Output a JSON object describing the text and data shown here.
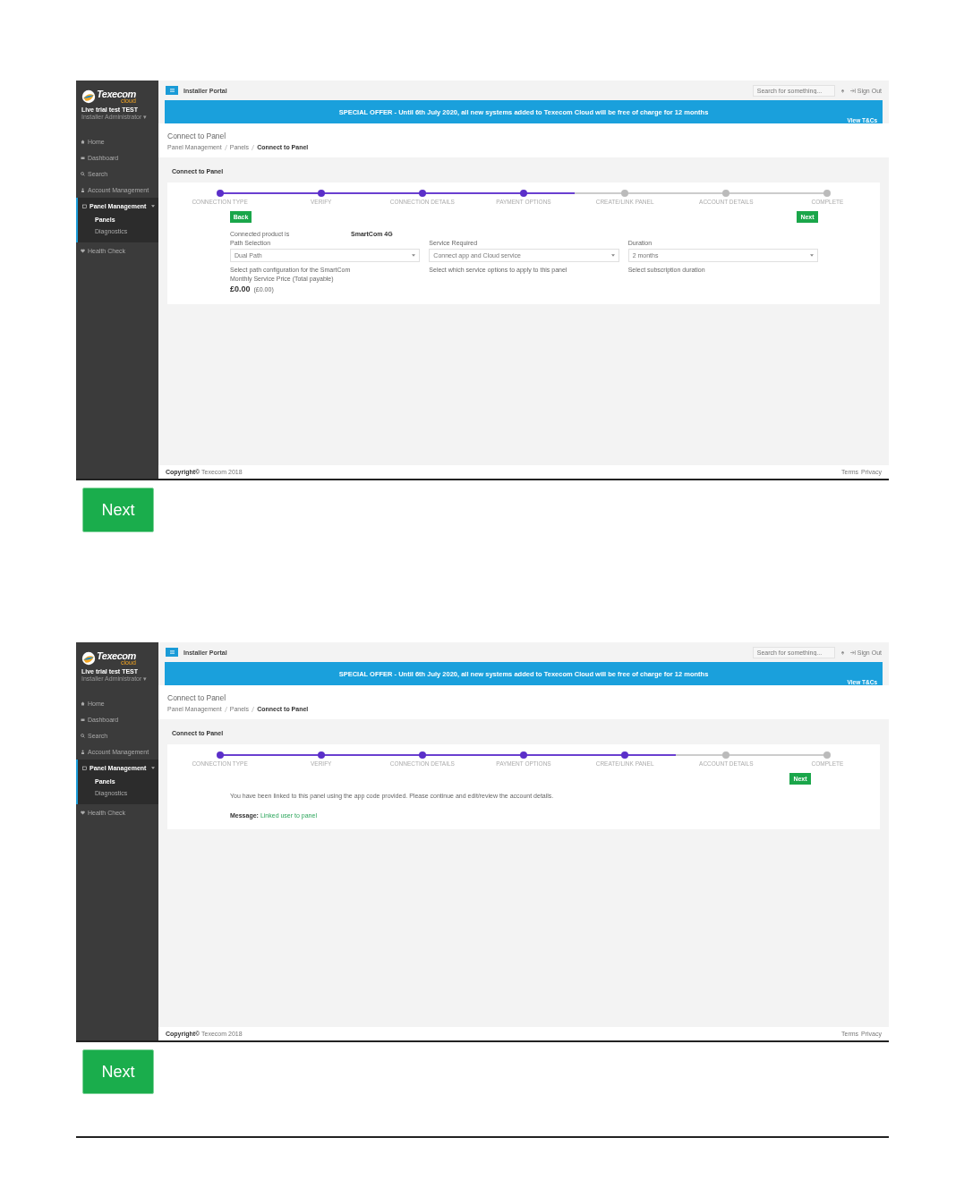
{
  "screenshots": [
    {
      "logo": {
        "name": "Texecom",
        "sub": "cloud"
      },
      "account": {
        "name": "Live trial test TEST",
        "role": "Installer Administrator ▾"
      },
      "nav": [
        {
          "label": "Home",
          "selected": false
        },
        {
          "label": "Dashboard",
          "selected": false
        },
        {
          "label": "Search",
          "selected": false
        },
        {
          "label": "Account Management",
          "selected": false
        },
        {
          "label": "Panel Management",
          "selected": true,
          "expanded": true,
          "children": [
            {
              "label": "Panels",
              "selected": true
            },
            {
              "label": "Diagnostics",
              "selected": false
            }
          ]
        },
        {
          "label": "Health Check",
          "selected": false
        }
      ],
      "header": {
        "title": "Installer Portal",
        "search_placeholder": "Search for something...",
        "sign_out": "Sign Out"
      },
      "banner": {
        "text": "SPECIAL OFFER - Until 6th July 2020, all new systems added to Texecom Cloud will be free of charge for 12 months",
        "link": "View T&Cs"
      },
      "page_title": "Connect to Panel",
      "breadcrumbs": [
        "Panel Management",
        "Panels",
        "Connect to Panel"
      ],
      "card_title": "Connect to Panel",
      "steps": [
        {
          "label": "CONNECTION TYPE",
          "done": true
        },
        {
          "label": "VERIFY",
          "done": true
        },
        {
          "label": "CONNECTION DETAILS",
          "done": true
        },
        {
          "label": "PAYMENT OPTIONS",
          "done": true
        },
        {
          "label": "CREATE/LINK PANEL",
          "done": false
        },
        {
          "label": "ACCOUNT DETAILS",
          "done": false
        },
        {
          "label": "COMPLETE",
          "done": false
        }
      ],
      "body": {
        "kind": "form",
        "back_button": "Back",
        "next_button": "Next",
        "product_label": "Connected product is",
        "product_value": "SmartCom 4G",
        "selects": [
          {
            "label": "Path Selection",
            "value": "Dual Path",
            "hint": "Select path configuration for the SmartCom"
          },
          {
            "label": "Service Required",
            "value": "Connect app and Cloud service",
            "hint": "Select which service options to apply to this panel"
          },
          {
            "label": "Duration",
            "value": "2 months",
            "hint": "Select subscription duration"
          }
        ],
        "price_label": "Monthly Service Price (Total payable)",
        "price": "£0.00",
        "price_note": "(£0.00)"
      },
      "footer": {
        "copyright": "**Copyright©** Texecom 2018",
        "links": [
          "Terms",
          "Privacy"
        ]
      }
    },
    {
      "logo": {
        "name": "Texecom",
        "sub": "cloud"
      },
      "account": {
        "name": "Live trial test TEST",
        "role": "Installer Administrator ▾"
      },
      "nav": [
        {
          "label": "Home",
          "selected": false
        },
        {
          "label": "Dashboard",
          "selected": false
        },
        {
          "label": "Search",
          "selected": false
        },
        {
          "label": "Account Management",
          "selected": false
        },
        {
          "label": "Panel Management",
          "selected": true,
          "expanded": true,
          "children": [
            {
              "label": "Panels",
              "selected": true
            },
            {
              "label": "Diagnostics",
              "selected": false
            }
          ]
        },
        {
          "label": "Health Check",
          "selected": false
        }
      ],
      "header": {
        "title": "Installer Portal",
        "search_placeholder": "Search for something...",
        "sign_out": "Sign Out"
      },
      "banner": {
        "text": "SPECIAL OFFER - Until 6th July 2020, all new systems added to Texecom Cloud will be free of charge for 12 months",
        "link": "View T&Cs"
      },
      "page_title": "Connect to Panel",
      "breadcrumbs": [
        "Panel Management",
        "Panels",
        "Connect to Panel"
      ],
      "card_title": "Connect to Panel",
      "steps": [
        {
          "label": "CONNECTION TYPE",
          "done": true
        },
        {
          "label": "VERIFY",
          "done": true
        },
        {
          "label": "CONNECTION DETAILS",
          "done": true
        },
        {
          "label": "PAYMENT OPTIONS",
          "done": true
        },
        {
          "label": "CREATE/LINK PANEL",
          "done": true
        },
        {
          "label": "ACCOUNT DETAILS",
          "done": false
        },
        {
          "label": "COMPLETE",
          "done": false
        }
      ],
      "body": {
        "kind": "message",
        "next_button": "Next",
        "text": "You have been linked to this panel using the app code provided. Please continue and edit/review the account details.",
        "message_label": "Message:",
        "message_value": "Linked user to panel"
      },
      "footer": {
        "copyright": "**Copyright©** Texecom 2018",
        "links": [
          "Terms",
          "Privacy"
        ]
      }
    }
  ],
  "next_buttons": [
    "Next",
    "Next"
  ]
}
